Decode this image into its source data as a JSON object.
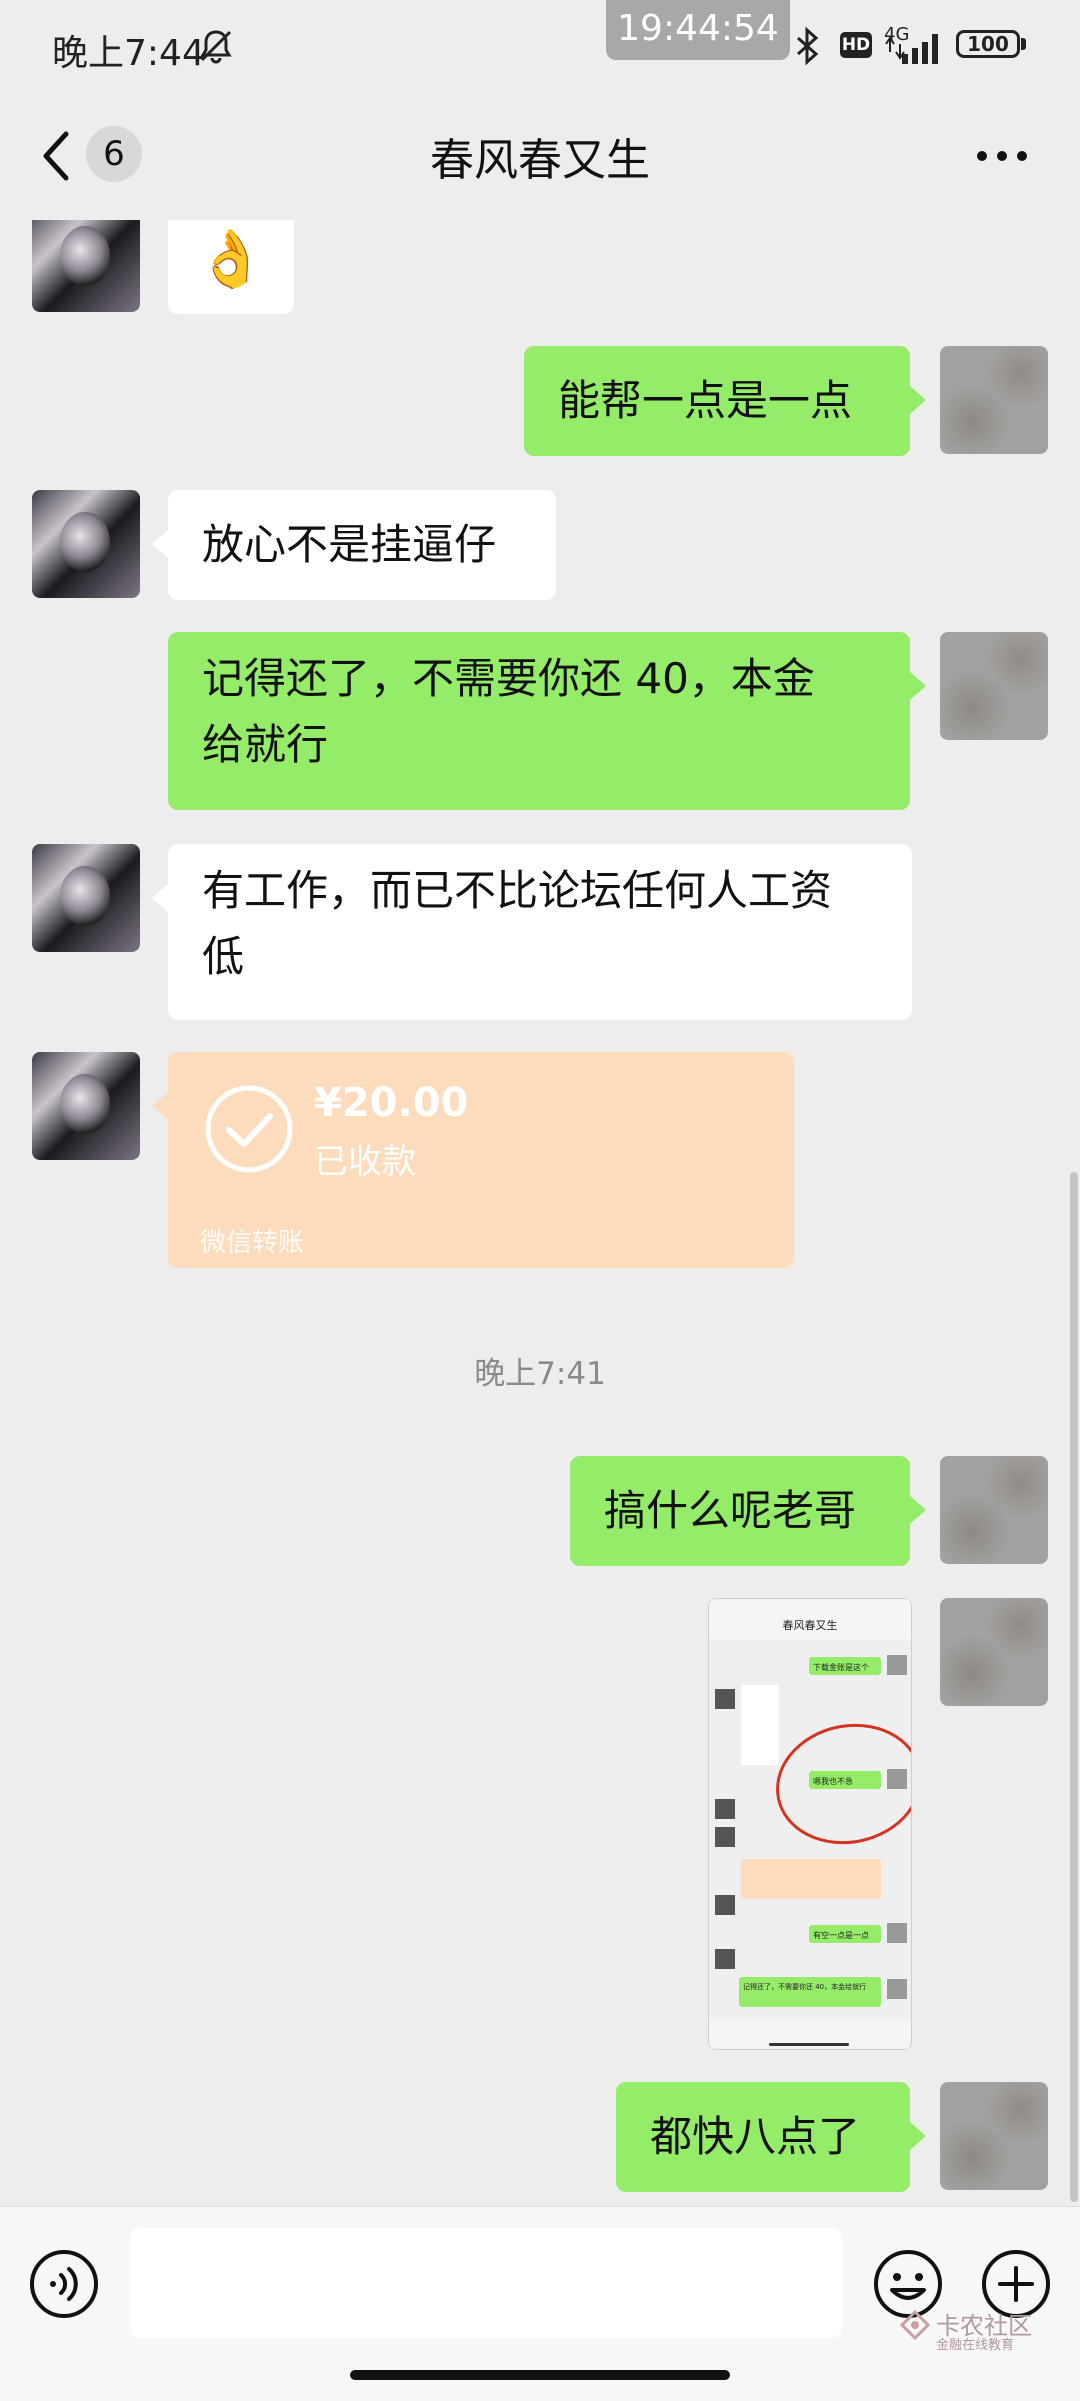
{
  "status_bar": {
    "time": "晚上7:44",
    "clock": "19:44:54",
    "hd": "HD",
    "network": "4G",
    "battery": "100"
  },
  "header": {
    "unread_count": "6",
    "title": "春风春又生"
  },
  "messages": {
    "m0_emoji": "👌",
    "m1": "能帮一点是一点",
    "m2": "放心不是挂逼仔",
    "m3_line1": "记得还了，不需要你还 40，本金",
    "m3_line2": "给就行",
    "m4_line1": "有工作，而已不比论坛任何人工资",
    "m4_line2": "低",
    "transfer_amount": "¥20.00",
    "transfer_status": "已收款",
    "transfer_source": "微信转账",
    "timestamp": "晚上7:41",
    "m5": "搞什么呢老哥",
    "m6": "都快八点了"
  },
  "thumbnail": {
    "title": "春风春又生",
    "b1": "下载金账是这个",
    "b2": "嗯我也不急",
    "b3": "有空一点是一点",
    "b4": "记得还了，不需要你还 40，本金给就行"
  },
  "watermark": {
    "name": "卡农社区",
    "sub": "金融在线教育"
  }
}
